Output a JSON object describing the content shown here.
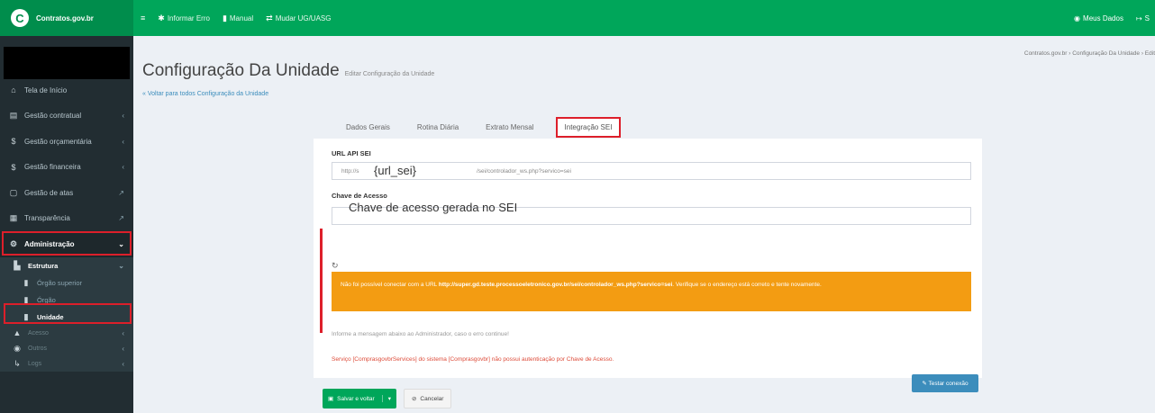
{
  "brand": {
    "name": "Contratos.gov.br",
    "logo": "C"
  },
  "top_menu": [
    {
      "icon": "menu-icon",
      "glyph": "≡",
      "label": ""
    },
    {
      "icon": "bug-icon",
      "glyph": "✱",
      "label": "Informar Erro"
    },
    {
      "icon": "book-icon",
      "glyph": "▮",
      "label": "Manual"
    },
    {
      "icon": "exchange-icon",
      "glyph": "⇄",
      "label": "Mudar UG/UASG"
    }
  ],
  "top_right": [
    {
      "glyph": "◉",
      "label": "Meus Dados"
    },
    {
      "glyph": "↦",
      "label": "S"
    }
  ],
  "sidebar": {
    "items": [
      {
        "glyph": "⌂",
        "label": "Tela de Início",
        "arrow": ""
      },
      {
        "glyph": "▤",
        "label": "Gestão contratual",
        "arrow": "‹"
      },
      {
        "glyph": "$",
        "label": "Gestão orçamentária",
        "arrow": "‹"
      },
      {
        "glyph": "$",
        "label": "Gestão financeira",
        "arrow": "‹"
      },
      {
        "glyph": "▢",
        "label": "Gestão de atas",
        "arrow": "↗"
      },
      {
        "glyph": "▦",
        "label": "Transparência",
        "arrow": "↗"
      },
      {
        "glyph": "⚙",
        "label": "Administração",
        "arrow": "⌄"
      }
    ],
    "estrutura": {
      "glyph": "▙",
      "label": "Estrutura",
      "arrow": "⌄"
    },
    "sub_items": [
      {
        "glyph": "▮",
        "label": "Órgão superior"
      },
      {
        "glyph": "▮",
        "label": "Órgão"
      },
      {
        "glyph": "▮",
        "label": "Unidade"
      }
    ],
    "muted_items": [
      {
        "glyph": "▲",
        "label": "Acesso",
        "arrow": "‹"
      },
      {
        "glyph": "◉",
        "label": "Outros",
        "arrow": "‹"
      },
      {
        "glyph": "↳",
        "label": "Logs",
        "arrow": "‹"
      }
    ]
  },
  "breadcrumb": "Contratos.gov.br  ›  Configuração Da Unidade  ›  Edit",
  "page": {
    "title": "Configuração Da Unidade",
    "subtitle": "Editar Configuração da Unidade",
    "back_link": "« Voltar para todos Configuração da Unidade"
  },
  "tabs": [
    "Dados Gerais",
    "Rotina Diária",
    "Extrato Mensal",
    "Integração SEI"
  ],
  "form": {
    "url_label": "URL API SEI",
    "url_prefix": "http://s",
    "url_value": "{url_sei}",
    "url_suffix": "/sei/controlador_ws.php?servico=sei",
    "key_label": "Chave de Acesso",
    "key_value": "Chave de acesso gerada no SEI",
    "warning_text": "Não foi possível conectar com a URL",
    "warning_url": "http://super.gd.teste.processoeletronico.gov.br/sei/controlador_ws.php?servico=sei",
    "warning_tail": ". Verifique se o endereço está correto e tente novamente.",
    "info_message": "Informe a mensagem abaixo ao Administrador, caso o erro continue!",
    "error_message": "Serviço [ComprasgovbrServices] do sistema [Comprasgovbr] não possui autenticação por Chave de Acesso.",
    "test_button": "✎ Testar conexão"
  },
  "footer": {
    "save_label": "Salvar e voltar",
    "cancel_label": "Cancelar"
  }
}
